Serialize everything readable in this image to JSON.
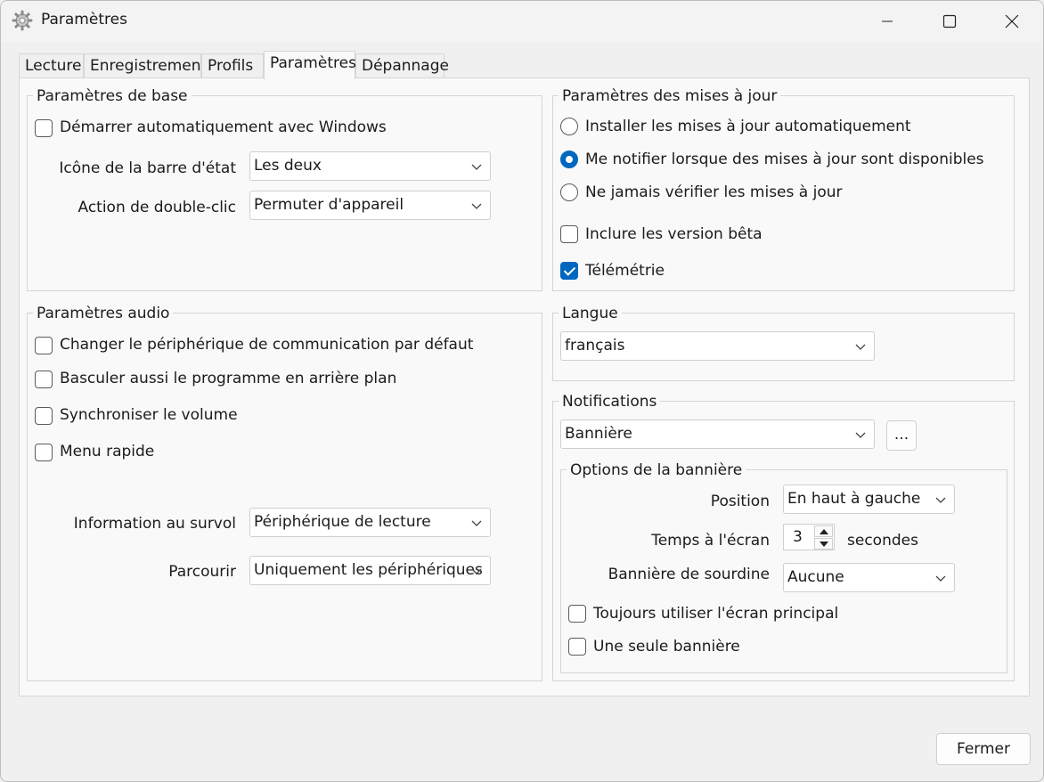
{
  "window": {
    "title": "Paramètres"
  },
  "tabs": [
    {
      "label": "Lecture"
    },
    {
      "label": "Enregistrement"
    },
    {
      "label": "Profils"
    },
    {
      "label": "Paramètres"
    },
    {
      "label": "Dépannage"
    }
  ],
  "active_tab": "Paramètres",
  "basic": {
    "title": "Paramètres de base",
    "autostart_label": "Démarrer automatiquement avec Windows",
    "autostart_checked": false,
    "tray_icon_label": "Icône de la barre d'état",
    "tray_icon_value": "Les deux",
    "double_click_label": "Action de double-clic",
    "double_click_value": "Permuter d'appareil"
  },
  "updates": {
    "title": "Paramètres des mises à jour",
    "options": [
      {
        "label": "Installer les mises à jour automatiquement",
        "selected": false
      },
      {
        "label": "Me notifier lorsque des mises à jour sont disponibles",
        "selected": true
      },
      {
        "label": "Ne jamais vérifier les mises à jour",
        "selected": false
      }
    ],
    "beta_label": "Inclure les version bêta",
    "beta_checked": false,
    "telemetry_label": "Télémétrie",
    "telemetry_checked": true
  },
  "audio": {
    "title": "Paramètres audio",
    "checkboxes": [
      {
        "label": "Changer le périphérique de communication par défaut",
        "checked": false
      },
      {
        "label": "Basculer aussi le programme en arrière plan",
        "checked": false
      },
      {
        "label": "Synchroniser le volume",
        "checked": false
      },
      {
        "label": "Menu rapide",
        "checked": false
      }
    ],
    "hover_info_label": "Information au survol",
    "hover_info_value": "Périphérique de lecture",
    "browse_label": "Parcourir",
    "browse_value": "Uniquement les périphériques"
  },
  "language": {
    "title": "Langue",
    "value": "français"
  },
  "notifications": {
    "title": "Notifications",
    "value": "Bannière",
    "more_button": "...",
    "banner_options": {
      "title": "Options de la bannière",
      "position_label": "Position",
      "position_value": "En haut à gauche",
      "screen_time_label": "Temps à l'écran",
      "screen_time_value": "3",
      "screen_time_unit": "secondes",
      "mute_banner_label": "Bannière de sourdine",
      "mute_banner_value": "Aucune",
      "primary_screen_label": "Toujours utiliser l'écran principal",
      "primary_screen_checked": false,
      "single_banner_label": "Une seule bannière",
      "single_banner_checked": false
    }
  },
  "footer": {
    "close_button": "Fermer"
  },
  "colors": {
    "accent": "#0067c0",
    "background": "#f0f0f0",
    "panel": "#f9f9f9"
  }
}
